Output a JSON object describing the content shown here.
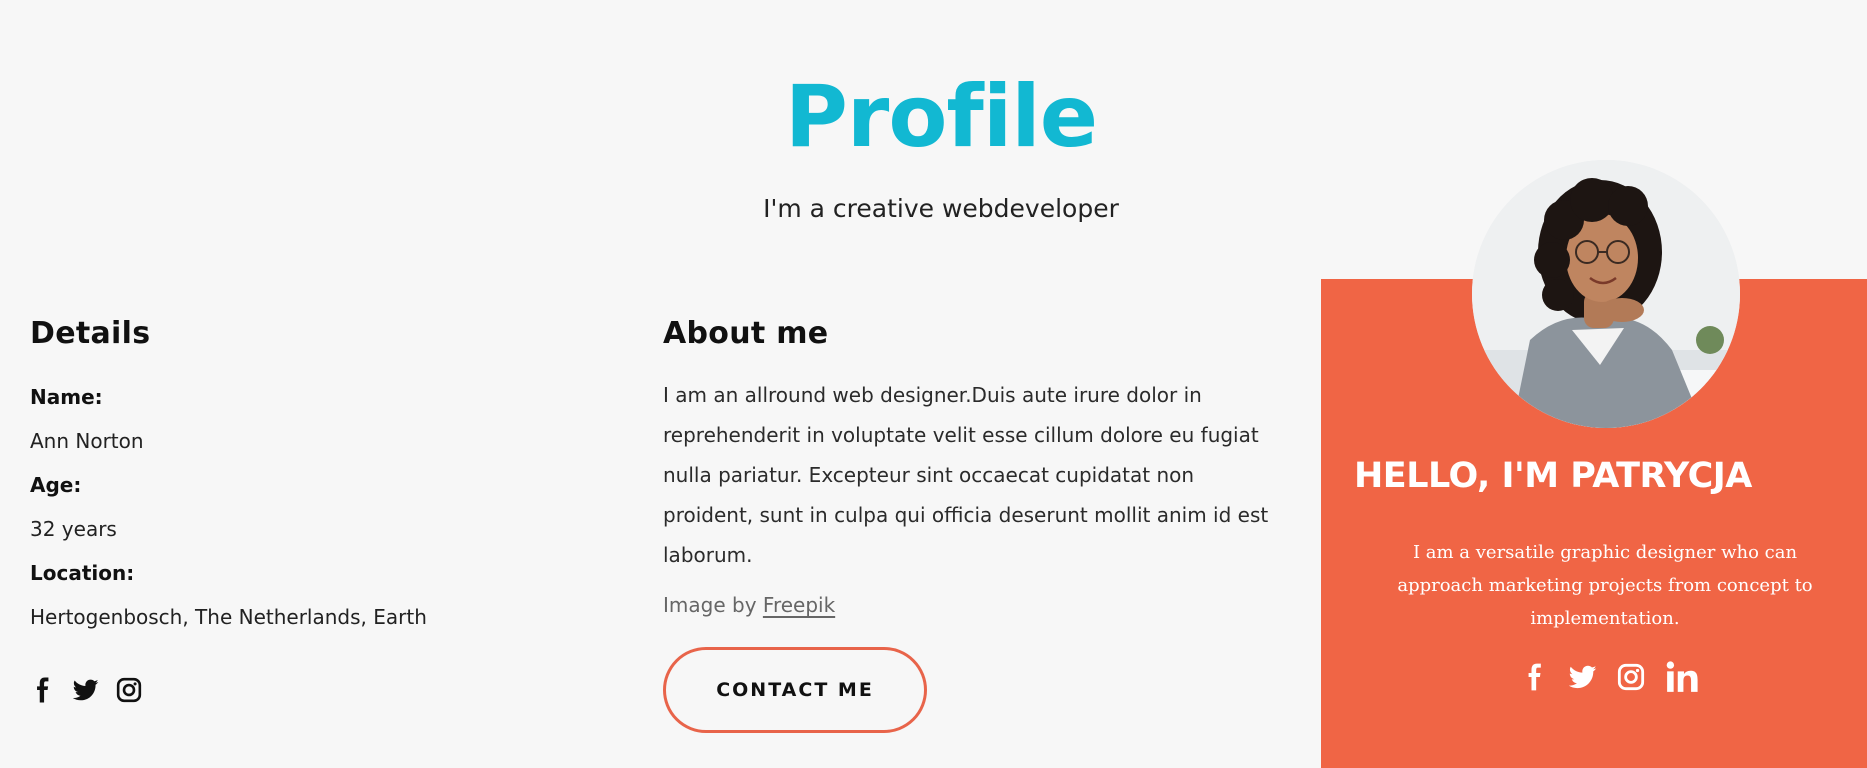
{
  "header": {
    "title": "Profile",
    "subtitle": "I'm a creative webdeveloper"
  },
  "details": {
    "heading": "Details",
    "name_label": "Name:",
    "name_value": "Ann Norton",
    "age_label": "Age:",
    "age_value": "32 years",
    "location_label": "Location:",
    "location_value": "Hertogenbosch, The Netherlands, Earth",
    "social_icons": [
      "facebook-icon",
      "twitter-icon",
      "instagram-icon"
    ]
  },
  "about": {
    "heading": "About me",
    "text": "I am an allround web designer.Duis aute irure dolor in reprehenderit in voluptate velit esse cillum dolore eu fugiat nulla pariatur. Excepteur sint occaecat cupidatat non proident, sunt in culpa qui officia deserunt mollit anim id est laborum.",
    "credit_prefix": "Image by",
    "credit_link": "Freepik",
    "contact_button": "CONTACT ME"
  },
  "card": {
    "title": "HELLO, I'M PATRYCJA",
    "text": "I am a versatile graphic designer who can approach marketing projects from concept to implementation.",
    "social_icons": [
      "facebook-icon",
      "twitter-icon",
      "instagram-icon",
      "linkedin-icon"
    ]
  },
  "colors": {
    "accent_cyan": "#12b8d2",
    "card_orange": "#f06545",
    "button_border": "#e8644a",
    "page_background": "#f7f7f7"
  }
}
